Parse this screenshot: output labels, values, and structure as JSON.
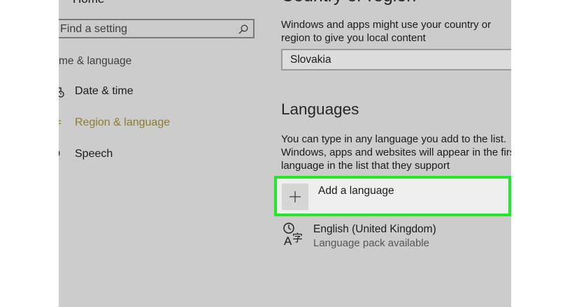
{
  "nav": {
    "home_label": "Home",
    "search_placeholder": "Find a setting",
    "section_heading": "me & language",
    "items": [
      {
        "label": "Date & time",
        "icon": "calendar-clock-icon"
      },
      {
        "label": "Region & language",
        "icon": "globe-icon",
        "active": true
      },
      {
        "label": "Speech",
        "icon": "microphone-icon"
      }
    ]
  },
  "country_region": {
    "title": "Country or region",
    "description": "Windows and apps might use your country or region to give you local content",
    "selected": "Slovakia"
  },
  "languages": {
    "title": "Languages",
    "description": "You can type in any language you add to the list. Windows, apps and websites will appear in the first language in the list that they support",
    "add_label": "Add a language",
    "installed": [
      {
        "name": "English (United Kingdom)",
        "status": "Language pack available"
      }
    ]
  },
  "colors": {
    "accent": "#8c7b2c",
    "highlight": "#23e82a",
    "background": "#cccccc"
  }
}
